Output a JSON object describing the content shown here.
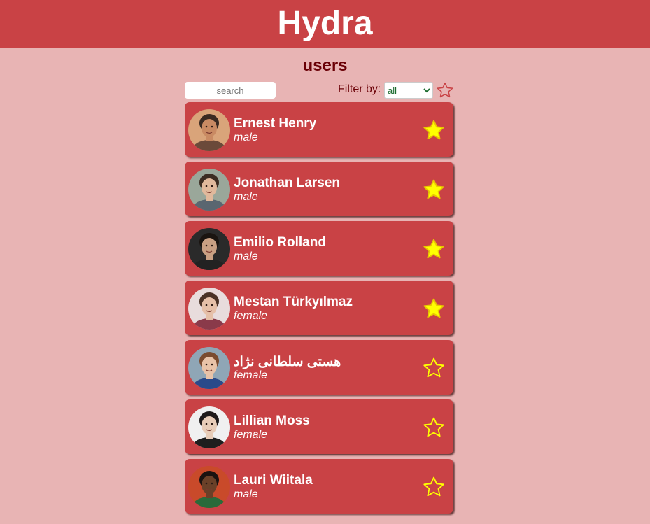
{
  "header": {
    "title": "Hydra"
  },
  "page": {
    "title": "users"
  },
  "controls": {
    "search_placeholder": "search",
    "filter_label": "Filter by:",
    "filter_selected": "all",
    "filter_star": "star-outline-icon"
  },
  "colors": {
    "header_bg": "#c94245",
    "page_bg": "#e8b4b4",
    "card_bg": "#c94245",
    "star_fill": "#ffff00",
    "title_text": "#6a0006"
  },
  "users": [
    {
      "name": "Ernest Henry",
      "gender": "male",
      "favorite": true,
      "avatar": "avatar-photo"
    },
    {
      "name": "Jonathan Larsen",
      "gender": "male",
      "favorite": true,
      "avatar": "avatar-photo"
    },
    {
      "name": "Emilio Rolland",
      "gender": "male",
      "favorite": true,
      "avatar": "avatar-photo"
    },
    {
      "name": "Mestan Türkyılmaz",
      "gender": "female",
      "favorite": true,
      "avatar": "avatar-photo"
    },
    {
      "name": "هستی سلطانی نژاد",
      "gender": "female",
      "favorite": false,
      "avatar": "avatar-photo"
    },
    {
      "name": "Lillian Moss",
      "gender": "female",
      "favorite": false,
      "avatar": "avatar-photo"
    },
    {
      "name": "Lauri Wiitala",
      "gender": "male",
      "favorite": false,
      "avatar": "avatar-photo"
    }
  ]
}
